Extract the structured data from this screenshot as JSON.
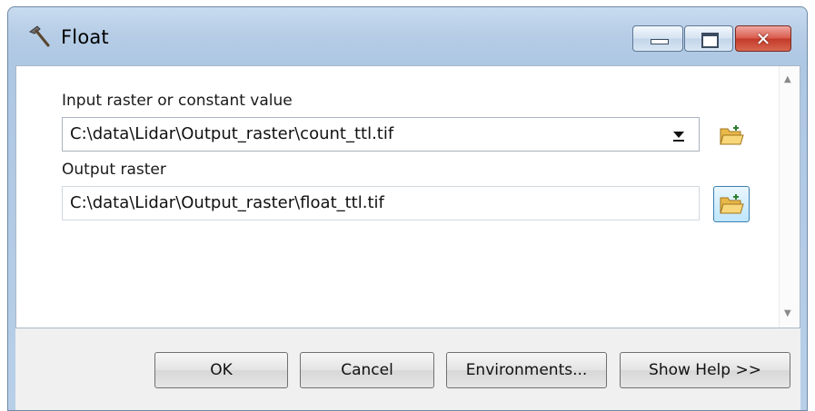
{
  "window": {
    "title": "Float",
    "icon": "hammer-icon",
    "caption_buttons": [
      "minimize-icon",
      "maximize-icon",
      "close-icon"
    ],
    "close_glyph": "✕"
  },
  "form": {
    "input_label": "Input raster or constant value",
    "input_value": "C:\\data\\Lidar\\Output_raster\\count_ttl.tif",
    "output_label": "Output raster",
    "output_value": "C:\\data\\Lidar\\Output_raster\\float_ttl.tif",
    "browse_icon": "open-folder-icon"
  },
  "buttons": {
    "ok": "OK",
    "cancel": "Cancel",
    "environments": "Environments...",
    "show_help": "Show Help >>"
  },
  "colors": {
    "title_bar": "#b6cde6",
    "close_button": "#c33a2a",
    "browse_highlight": "#bee6fd"
  }
}
